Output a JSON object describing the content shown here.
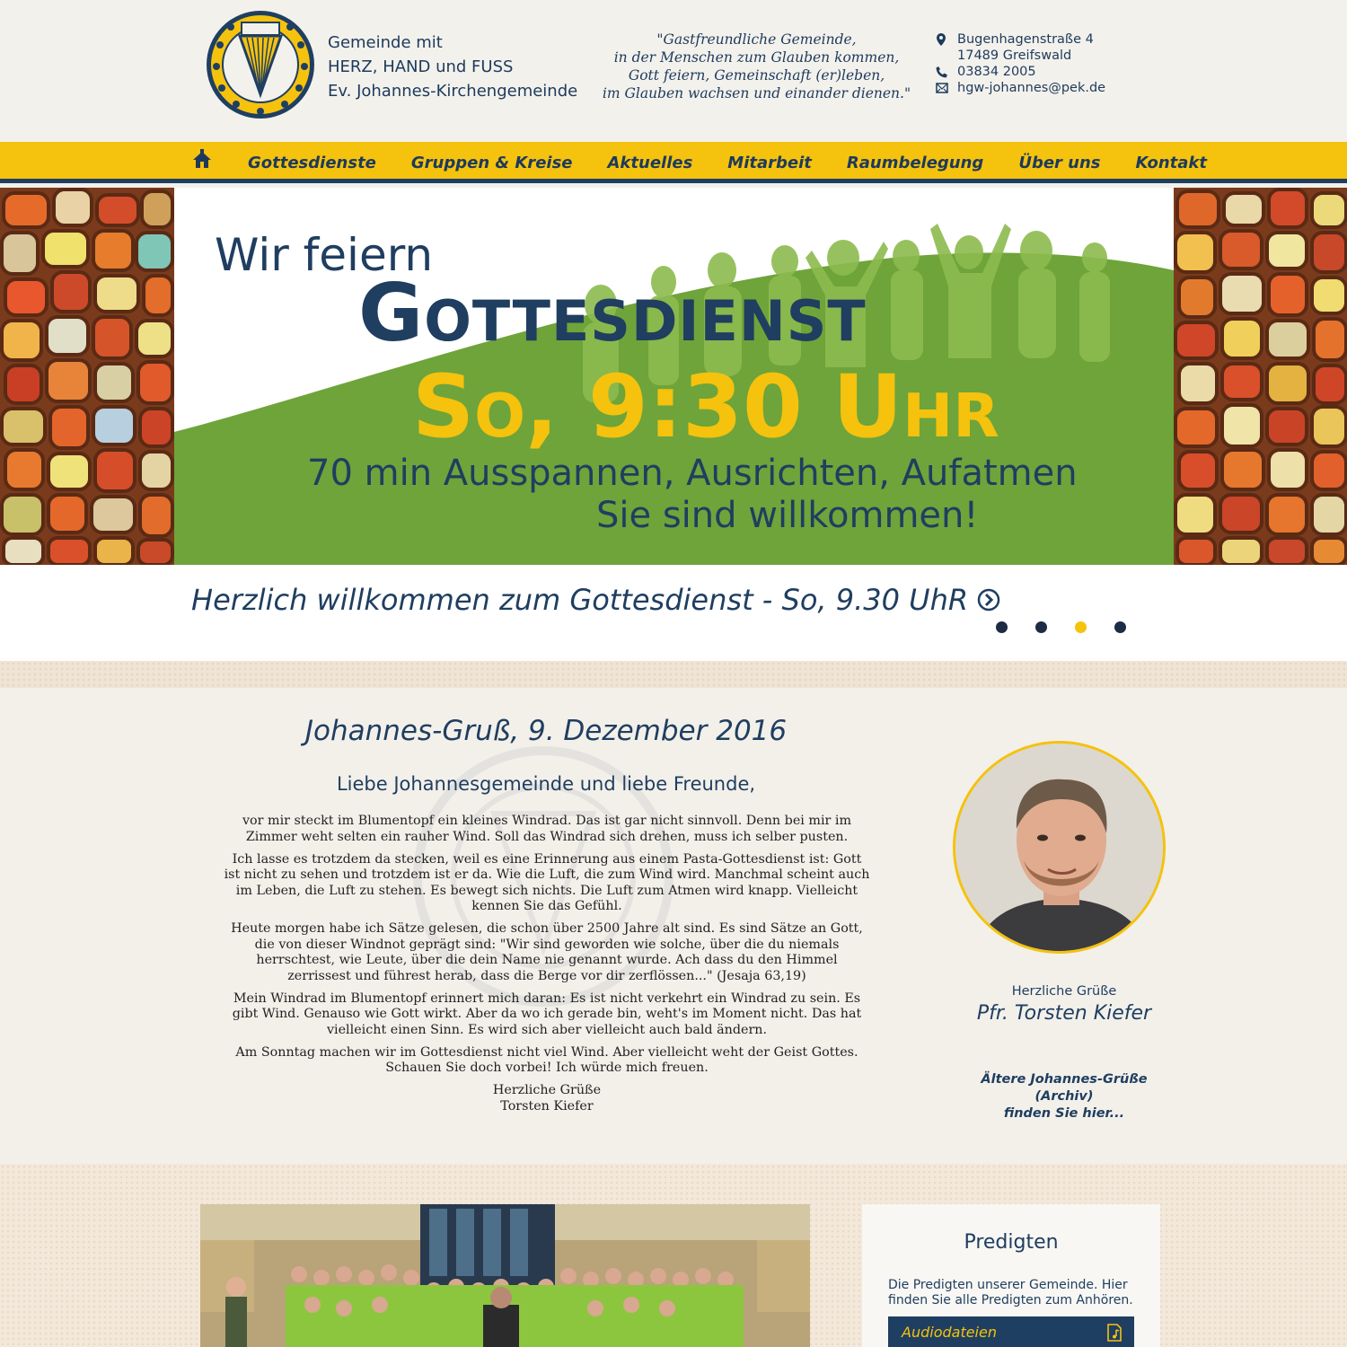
{
  "header": {
    "brand_lines": [
      "Gemeinde mit",
      "HERZ, HAND und FUSS",
      "Ev. Johannes-Kirchengemeinde"
    ],
    "motto_lines": [
      "\"Gastfreundliche Gemeinde,",
      "in der Menschen zum Glauben kommen,",
      "Gott feiern, Gemeinschaft (er)leben,",
      "im Glauben wachsen und einander dienen.\""
    ],
    "address_street": "Bugenhagenstraße 4",
    "address_city": "17489 Greifswald",
    "phone": "03834 2005",
    "email": "hgw-johannes@pek.de",
    "icons": {
      "address": "location-pin-icon",
      "phone": "phone-icon",
      "email": "envelope-icon"
    }
  },
  "nav": {
    "home_icon": "home-icon",
    "items": [
      "Gottesdienste",
      "Gruppen & Kreise",
      "Aktuelles",
      "Mitarbeit",
      "Raumbelegung",
      "Über uns",
      "Kontakt"
    ]
  },
  "hero": {
    "line1": "Wir feiern",
    "line2": "Gottesdienst",
    "line3": "So, 9:30 Uhr",
    "line4": "70 min Ausspannen, Ausrichten, Aufatmen",
    "line5": "Sie sind willkommen!"
  },
  "slider": {
    "caption": "Herzlich willkommen zum Gottesdienst - So, 9.30 UhR",
    "active_index": 2,
    "count": 4
  },
  "greeting": {
    "title": "Johannes-Gruß, 9. Dezember 2016",
    "salutation": "Liebe Johannesgemeinde und liebe Freunde,",
    "paragraphs": [
      "vor mir steckt im Blumentopf ein kleines Windrad. Das ist gar nicht sinnvoll. Denn bei mir im Zimmer weht selten ein rauher Wind. Soll das Windrad sich drehen, muss ich selber pusten.",
      "Ich lasse es trotzdem da stecken, weil es eine Erinnerung aus einem Pasta-Gottesdienst ist: Gott ist nicht zu sehen und trotzdem ist er da. Wie die Luft, die zum Wind wird. Manchmal scheint auch im Leben, die Luft zu stehen. Es bewegt sich nichts. Die Luft zum Atmen wird knapp. Vielleicht kennen Sie das Gefühl.",
      "Heute morgen habe ich Sätze gelesen, die schon über 2500 Jahre alt sind. Es sind Sätze an Gott, die von dieser Windnot geprägt sind: \"Wir sind geworden wie solche, über die du niemals herrschtest, wie Leute, über die dein Name nie genannt wurde. Ach dass du den Himmel zerrissest und führest herab, dass die Berge vor dir zerflössen...\" (Jesaja 63,19)",
      "Mein Windrad im Blumentopf erinnert mich daran: Es ist nicht verkehrt ein Windrad zu sein. Es gibt Wind. Genauso wie Gott wirkt. Aber da wo ich gerade bin, weht's im Moment nicht. Das hat vielleicht einen Sinn. Es wird sich aber vielleicht auch bald ändern.",
      "Am Sonntag machen wir im Gottesdienst nicht viel Wind. Aber vielleicht weht der Geist Gottes. Schauen Sie doch vorbei! Ich würde mich freuen."
    ],
    "closing": "Herzliche Grüße",
    "closing_name": "Torsten Kiefer",
    "sidebar_label": "Herzliche Grüße",
    "sidebar_name": "Pfr. Torsten Kiefer",
    "archive_line1": "Ältere Johannes-Grüße (Archiv)",
    "archive_line2": "finden Sie hier..."
  },
  "predigten": {
    "title": "Predigten",
    "text": "Die Predigten unserer Gemeinde. Hier finden Sie alle Predigten zum Anhören.",
    "button": "Audiodateien",
    "button_icon": "audio-file-icon"
  },
  "colors": {
    "accent": "#f5c20d",
    "navy": "#1f3e60",
    "green": "#6ea43a"
  }
}
